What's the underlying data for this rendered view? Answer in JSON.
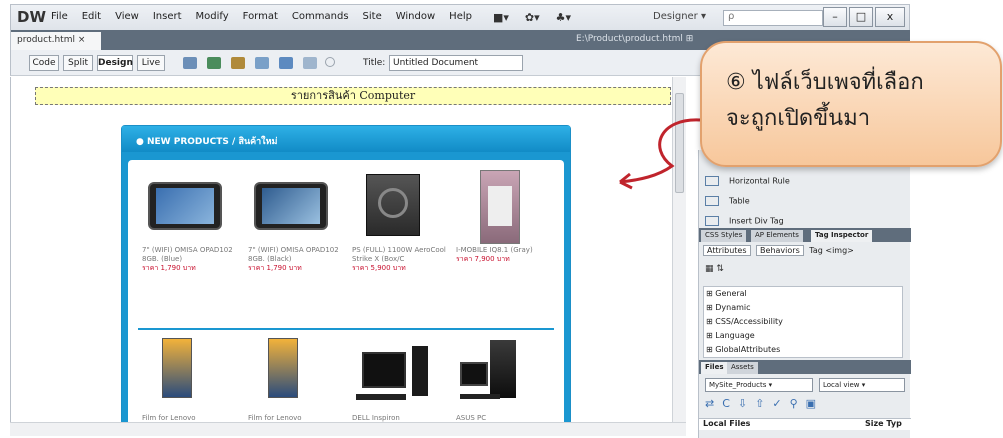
{
  "app": {
    "logo": "DW"
  },
  "menu": [
    "File",
    "Edit",
    "View",
    "Insert",
    "Modify",
    "Format",
    "Commands",
    "Site",
    "Window",
    "Help"
  ],
  "toolbar_icons": [
    "■▾",
    "✿▾",
    "♣▾"
  ],
  "workspace": "Designer ▾",
  "search": {
    "placeholder": "ρ"
  },
  "window_buttons": {
    "minimize": "–",
    "maximize": "□",
    "close": "x"
  },
  "document": {
    "tab": "product.html ×",
    "path": "E:\\Product\\product.html ⊞"
  },
  "view_buttons": [
    "Code",
    "Split",
    "Design",
    "Live"
  ],
  "title_field": {
    "label": "Title:",
    "value": "Untitled Document"
  },
  "page": {
    "heading": "รายการสินค้า Computer",
    "panel_heading": "● NEW PRODUCTS / สินค้าใหม่",
    "products_row1": [
      {
        "name": "7\" (WIFI) OMISA OPAD102 8GB. (Blue)",
        "price": "ราคา 1,790 บาท"
      },
      {
        "name": "7\" (WIFI) OMISA OPAD102 8GB. (Black)",
        "price": "ราคา 1,790 บาท"
      },
      {
        "name": "PS (FULL) 1100W AeroCool Strike X (Box/C",
        "price": "ราคา 5,900 บาท"
      },
      {
        "name": "I-MOBILE IQ8.1 (Gray)",
        "price": "ราคา 7,900 บาท"
      }
    ],
    "products_row2_labels": [
      "Film for Lenovo",
      "Film for Lenovo",
      "DELL Inspiron",
      "ASUS PC"
    ]
  },
  "insert_panel": {
    "items": [
      "Horizontal Rule",
      "Table",
      "Insert Div Tag"
    ]
  },
  "tag_panel": {
    "tabs": [
      "CSS Styles",
      "AP Elements",
      "Tag Inspector"
    ],
    "subtabs": [
      "Attributes",
      "Behaviors"
    ],
    "tag_label": "Tag <img>",
    "categories": [
      "⊞ General",
      "⊞ Dynamic",
      "⊞ CSS/Accessibility",
      "⊞ Language",
      "⊞ GlobalAttributes"
    ]
  },
  "files_panel": {
    "tabs": [
      "Files",
      "Assets"
    ],
    "site": "MySite_Products",
    "view": "Local view",
    "header_local": "Local Files",
    "header_size": "Size Typ"
  },
  "callout": {
    "number": "⑥",
    "line1": "ไฟล์เว็บเพจที่เลือก",
    "line2": "จะถูกเปิดขึ้นมา"
  }
}
